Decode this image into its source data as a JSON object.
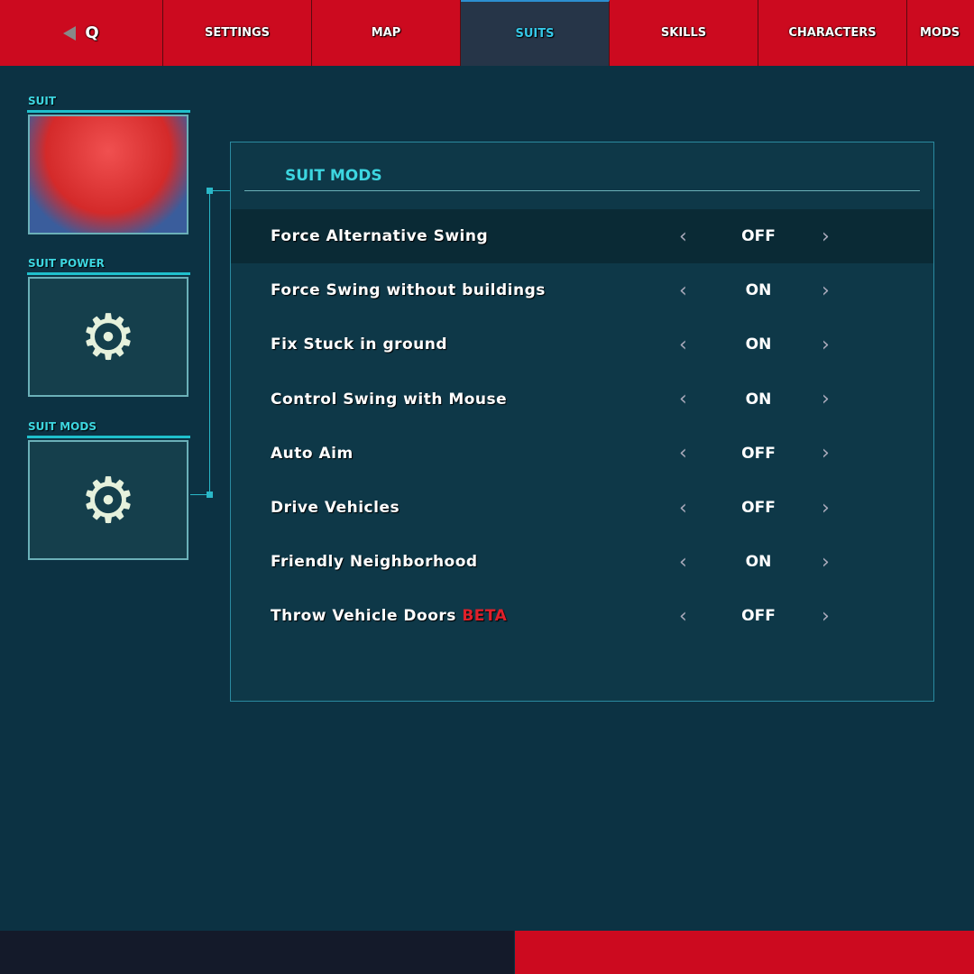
{
  "tabs": {
    "back_key": "Q",
    "items": [
      "SETTINGS",
      "MAP",
      "SUITS",
      "SKILLS",
      "CHARACTERS",
      "MODS"
    ],
    "active": "SUITS"
  },
  "sidebar": {
    "suit_label": "SUIT",
    "suit_power_label": "SUIT POWER",
    "suit_mods_label": "SUIT MODS"
  },
  "panel": {
    "title": "SUIT MODS",
    "beta_label": "BETA",
    "rows": [
      {
        "label": "Force Alternative Swing",
        "value": "OFF"
      },
      {
        "label": "Force Swing without buildings",
        "value": "ON"
      },
      {
        "label": "Fix Stuck in ground",
        "value": "ON"
      },
      {
        "label": "Control Swing with Mouse",
        "value": "ON"
      },
      {
        "label": "Auto Aim",
        "value": "OFF"
      },
      {
        "label": "Drive Vehicles",
        "value": "OFF"
      },
      {
        "label": "Friendly Neighborhood",
        "value": "ON"
      },
      {
        "label": "Throw Vehicle Doors",
        "value": "OFF"
      }
    ]
  },
  "colors": {
    "accent": "#3dd6e0",
    "red": "#cc0a1f",
    "background": "#0c3243"
  }
}
